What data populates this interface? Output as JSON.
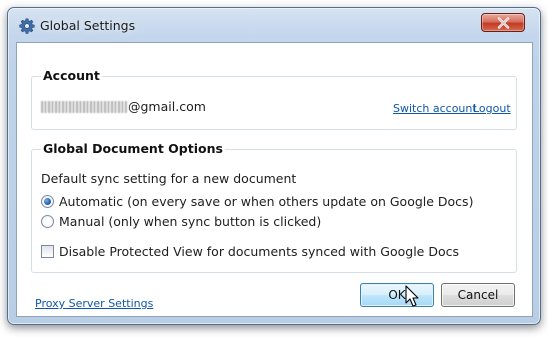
{
  "window": {
    "title": "Global Settings"
  },
  "account": {
    "heading": "Account",
    "email_suffix": "@gmail.com",
    "switch_account_label": "Switch account",
    "logout_label": "Logout"
  },
  "options": {
    "heading": "Global Document Options",
    "sync_caption": "Default sync setting for a new document",
    "radio_automatic_label": "Automatic (on every save or when others update on Google Docs)",
    "radio_manual_label": "Manual (only when sync button is clicked)",
    "selected": "automatic",
    "checkbox_label": "Disable Protected View for documents synced with Google Docs",
    "checkbox_checked": false
  },
  "footer": {
    "proxy_link_label": "Proxy Server Settings",
    "ok_label": "OK",
    "cancel_label": "Cancel"
  },
  "colors": {
    "link": "#0f57a8",
    "radio_selected": "#2a64b4",
    "close_button": "#c23b25"
  },
  "icons": {
    "app": "gear-icon",
    "close": "close-icon",
    "pointer": "mouse-pointer-icon"
  }
}
